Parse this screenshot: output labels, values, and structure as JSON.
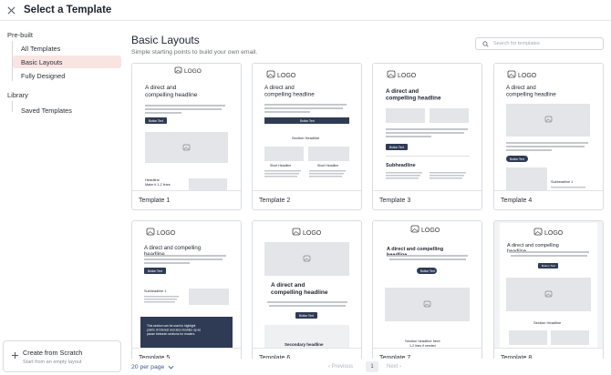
{
  "header": {
    "title": "Select a Template"
  },
  "sidebar": {
    "prebuilt_label": "Pre-built",
    "items": [
      {
        "label": "All Templates"
      },
      {
        "label": "Basic Layouts"
      },
      {
        "label": "Fully Designed"
      }
    ],
    "library_label": "Library",
    "library_items": [
      {
        "label": "Saved Templates"
      }
    ],
    "scratch": {
      "title": "Create from Scratch",
      "subtitle": "Start from an empty layout"
    }
  },
  "main": {
    "title": "Basic Layouts",
    "subtitle": "Simple starting points to build your own email.",
    "search_placeholder": "Search for templates",
    "templates": [
      {
        "label": "Template 1"
      },
      {
        "label": "Template 2"
      },
      {
        "label": "Template 3"
      },
      {
        "label": "Template 4"
      },
      {
        "label": "Template 5"
      },
      {
        "label": "Template 6"
      },
      {
        "label": "Template 7"
      },
      {
        "label": "Template 8"
      }
    ]
  },
  "preview": {
    "logo": "LOGO",
    "headline": "A direct and compelling headline",
    "body": "Your copy should address 3 key questions: Who am I writing for (audience)? Why should they care (benefit)? What do I want them to do (call-to-action)?",
    "button": "Button Text",
    "headline_small": "Headline",
    "make_it": "Make it 1-2 lines",
    "section_headline": "Section Headline",
    "short_headline": "Short Headline",
    "subheadline": "Subheadline",
    "subheadline_1": "Subheadline 1",
    "secondary_headline": "Secondary headline",
    "section_headline_here": "Section headline here",
    "lines_needed": "1-2 lines if needed",
    "dark_text": "This section can be used to highlight points of interest and also doubles up as pause between sections for readers.",
    "body_short": "If readers need to know more details, this section can add supporting info."
  },
  "pagination": {
    "per_page": "20 per page",
    "previous": "Previous",
    "page": "1",
    "next": "Next"
  },
  "colors": {
    "active_bg": "#fae4e2",
    "accent": "#3d5a8a",
    "dark_button": "#2f3b55"
  }
}
